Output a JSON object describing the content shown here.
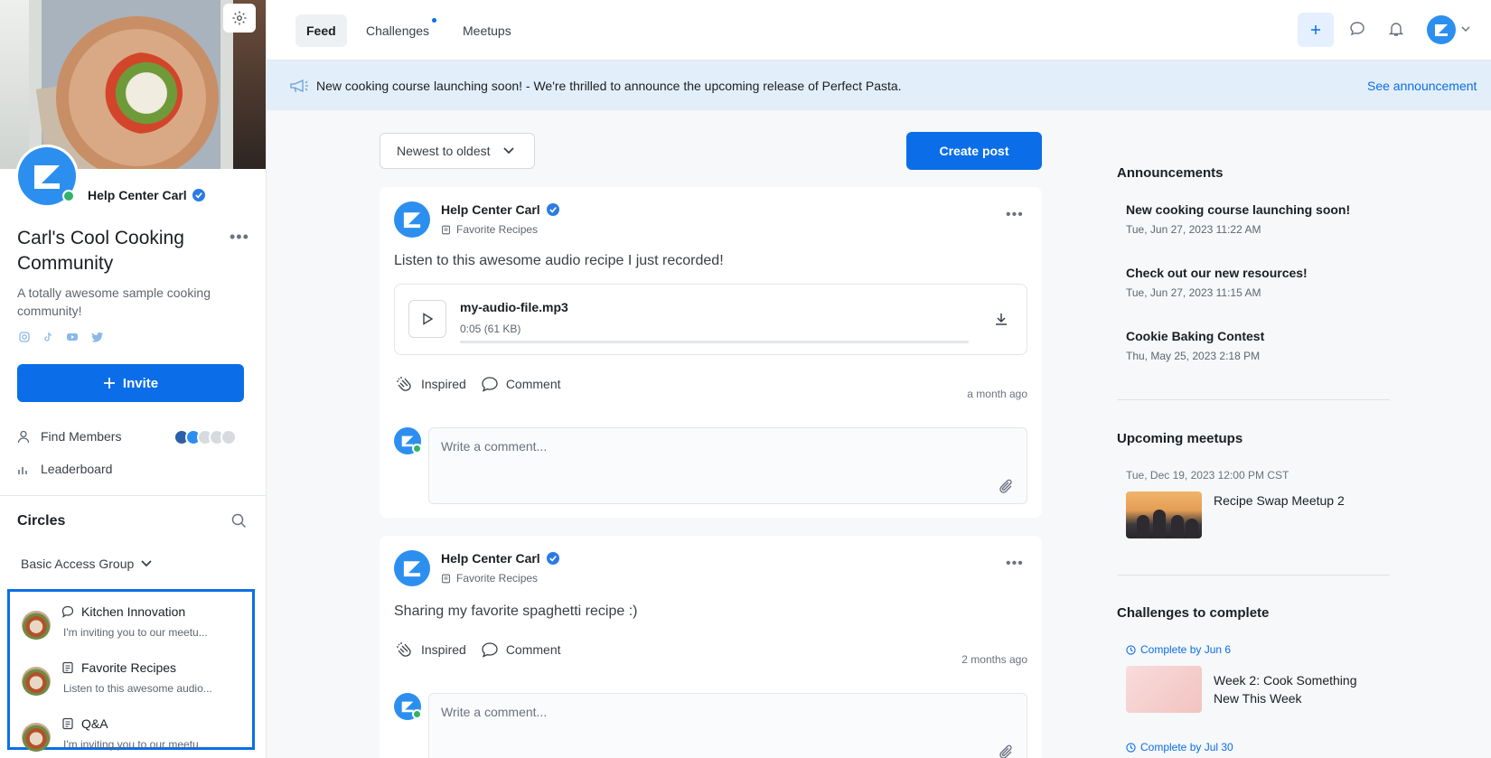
{
  "sidebar": {
    "owner_name": "Help Center Carl",
    "community_title": "Carl's Cool Cooking Community",
    "community_desc": "A totally awesome sample cooking community!",
    "invite_label": "Invite",
    "find_members_label": "Find Members",
    "leaderboard_label": "Leaderboard",
    "circles_title": "Circles",
    "group_select": "Basic Access Group",
    "circles": [
      {
        "title": "Kitchen Innovation",
        "icon": "chat-bubble-icon",
        "subtitle": "I'm inviting you to our meetu..."
      },
      {
        "title": "Favorite Recipes",
        "icon": "document-icon",
        "subtitle": "Listen to this awesome audio..."
      },
      {
        "title": "Q&A",
        "icon": "document-icon",
        "subtitle": "I'm inviting you to our meetu..."
      }
    ]
  },
  "topnav": {
    "tabs": [
      {
        "label": "Feed",
        "active": true
      },
      {
        "label": "Challenges",
        "active": false
      },
      {
        "label": "Meetups",
        "active": false
      }
    ]
  },
  "announcement_bar": {
    "text": "New cooking course launching soon! - We're thrilled to announce the upcoming release of Perfect Pasta.",
    "link": "See announcement"
  },
  "feed": {
    "sort_label": "Newest to oldest",
    "create_post_label": "Create post",
    "posts": [
      {
        "author": "Help Center Carl",
        "circle": "Favorite Recipes",
        "body": "Listen to this awesome audio recipe I just recorded!",
        "audio": {
          "file_name": "my-audio-file.mp3",
          "meta": "0:05 (61 KB)"
        },
        "inspired_label": "Inspired",
        "comment_label": "Comment",
        "time": "a month ago",
        "comment_placeholder": "Write a comment..."
      },
      {
        "author": "Help Center Carl",
        "circle": "Favorite Recipes",
        "body": "Sharing my favorite spaghetti recipe :)",
        "inspired_label": "Inspired",
        "comment_label": "Comment",
        "time": "2 months ago",
        "comment_placeholder": "Write a comment..."
      }
    ]
  },
  "right": {
    "announcements_title": "Announcements",
    "announcements": [
      {
        "title": "New cooking course launching soon!",
        "date": "Tue, Jun 27, 2023 11:22 AM"
      },
      {
        "title": "Check out our new resources!",
        "date": "Tue, Jun 27, 2023 11:15 AM"
      },
      {
        "title": "Cookie Baking Contest",
        "date": "Thu, May 25, 2023 2:18 PM"
      }
    ],
    "meetups_title": "Upcoming meetups",
    "meetup": {
      "date": "Tue, Dec 19, 2023 12:00 PM CST",
      "title": "Recipe Swap Meetup 2"
    },
    "challenges_title": "Challenges to complete",
    "challenges": [
      {
        "deadline": "Complete by Jun 6",
        "title": "Week 2: Cook Something New This Week"
      },
      {
        "deadline": "Complete by Jul 30"
      }
    ]
  },
  "colors": {
    "accent": "#0b6ee8",
    "announcement_bg": "#e2eefa",
    "online": "#30b36b"
  }
}
